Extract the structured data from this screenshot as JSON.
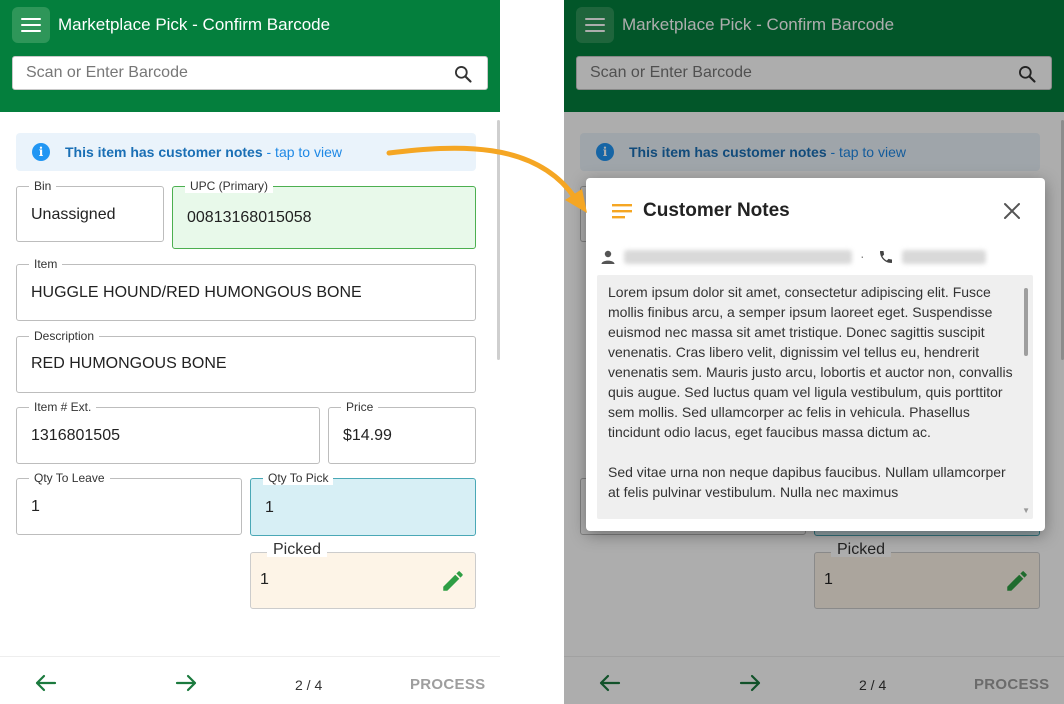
{
  "app": {
    "title": "Marketplace Pick - Confirm Barcode"
  },
  "search": {
    "placeholder": "Scan or Enter Barcode"
  },
  "banner": {
    "strong": "This item has customer notes",
    "light": " - tap to view"
  },
  "fields": {
    "bin": {
      "label": "Bin",
      "value": "Unassigned"
    },
    "upc": {
      "label": "UPC (Primary)",
      "value": "00813168015058"
    },
    "item": {
      "label": "Item",
      "value": "HUGGLE HOUND/RED HUMONGOUS BONE"
    },
    "description": {
      "label": "Description",
      "value": "RED HUMONGOUS BONE"
    },
    "item_ext": {
      "label": "Item # Ext.",
      "value": "1316801505"
    },
    "price": {
      "label": "Price",
      "value": "$14.99"
    },
    "qty_leave": {
      "label": "Qty To Leave",
      "value": "1"
    },
    "qty_pick": {
      "label": "Qty To Pick",
      "value": "1"
    },
    "picked": {
      "label": "Picked",
      "value": "1"
    }
  },
  "bottom": {
    "pager": "2 / 4",
    "process_label": "PROCESS"
  },
  "modal": {
    "title": "Customer Notes",
    "separator": "·",
    "notes": "Lorem ipsum dolor sit amet, consectetur adipiscing elit. Fusce mollis finibus arcu, a semper ipsum laoreet eget. Suspendisse euismod nec massa sit amet tristique. Donec sagittis suscipit venenatis. Cras libero velit, dignissim vel tellus eu, hendrerit venenatis sem. Mauris justo arcu, lobortis et auctor non, convallis quis augue. Sed luctus quam vel ligula vestibulum, quis porttitor sem mollis. Sed ullamcorper ac felis in vehicula. Phasellus tincidunt odio lacus, eget faucibus massa dictum ac.\n\nSed vitae urna non neque dapibus faucibus. Nullam ullamcorper at felis pulvinar vestibulum. Nulla nec maximus"
  },
  "colors": {
    "appbar": "#047f3d",
    "upc_field_bg": "#e8f9ea",
    "qty_pick_bg": "#d7eff5",
    "picked_bg": "#fdf4e7",
    "callout_arrow": "#f5a623",
    "info_blue": "#2196f3",
    "pencil_green": "#2e9e45"
  },
  "icons": [
    "menu-icon",
    "search-icon",
    "info-icon",
    "pencil-icon",
    "arrow-left-icon",
    "arrow-right-icon",
    "notes-icon",
    "close-icon",
    "person-icon",
    "phone-icon"
  ]
}
